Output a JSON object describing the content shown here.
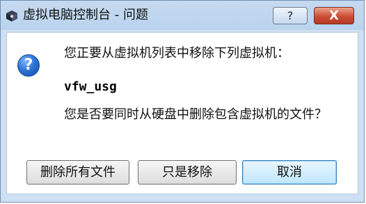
{
  "window": {
    "title": "虚拟电脑控制台 - 问题",
    "help_label": "?",
    "close_label": "X"
  },
  "icons": {
    "title_icon": "virtualbox-cube-icon",
    "message_icon": "question-icon"
  },
  "message": {
    "line1": "您正要从虚拟机列表中移除下列虚拟机：",
    "vm_name": "vfw_usg",
    "line2": "您是否要同时从硬盘中删除包含虚拟机的文件？"
  },
  "buttons": {
    "delete_all": "删除所有文件",
    "remove_only": "只是移除",
    "cancel": "取消"
  },
  "colors": {
    "titlebar": "#bad3ee",
    "close_button": "#cc4c33",
    "question_icon": "#2f74d6"
  }
}
